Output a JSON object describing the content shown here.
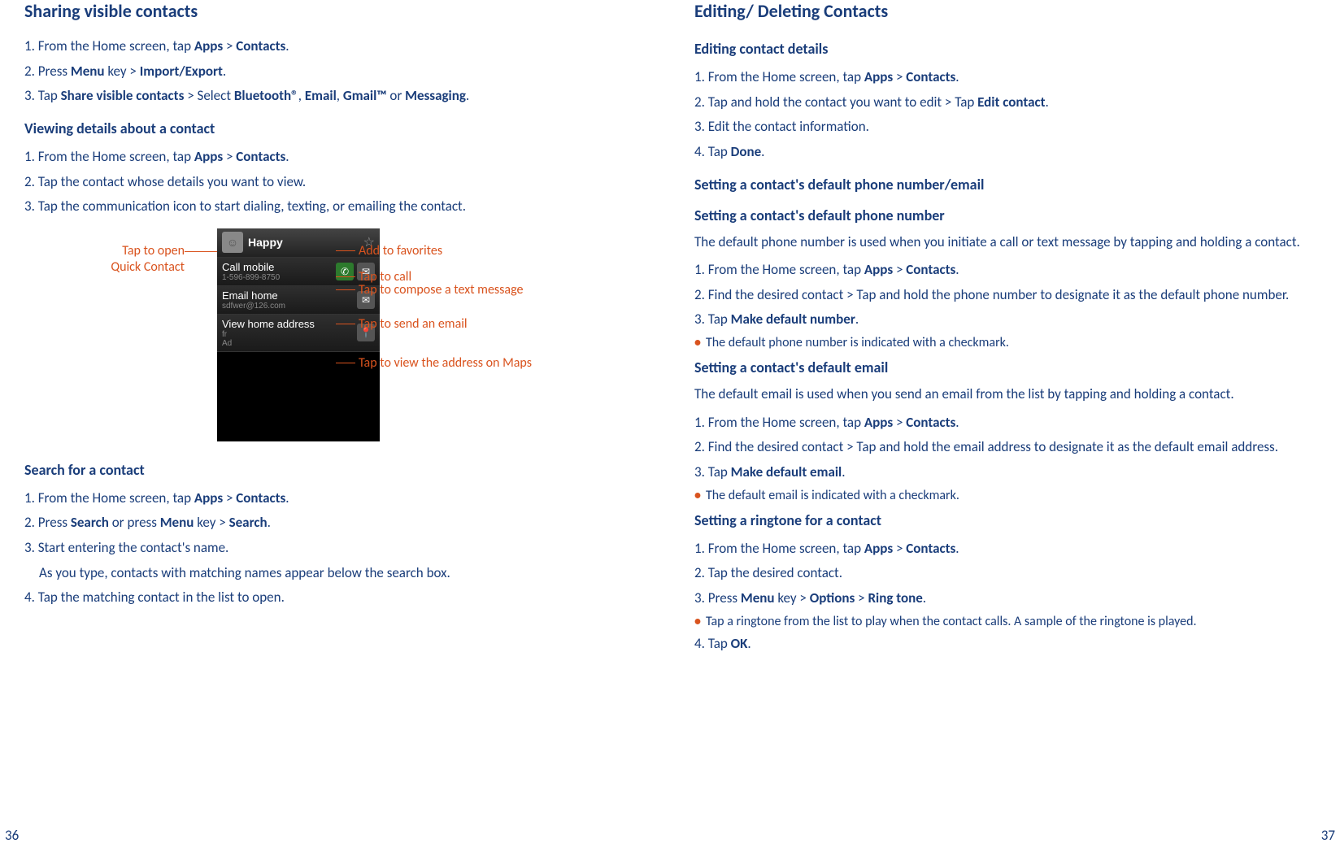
{
  "left": {
    "h_share": "Sharing visible contacts",
    "share_s1a": "1. From the Home screen, tap ",
    "share_s1b": "Apps",
    "share_s1c": " > ",
    "share_s1d": "Contacts",
    "share_s1e": ".",
    "share_s2a": "2. Press ",
    "share_s2b": "Menu",
    "share_s2c": " key > ",
    "share_s2d": "Import/Export",
    "share_s2e": ".",
    "share_s3a": "3. Tap ",
    "share_s3b": "Share visible contacts",
    "share_s3c": " > Select ",
    "share_s3d": "Bluetooth®",
    "share_s3e": ", ",
    "share_s3f": "Email",
    "share_s3g": ", ",
    "share_s3h": "Gmail™",
    "share_s3i": " or ",
    "share_s3j": "Messaging",
    "share_s3k": ".",
    "h_view": "Viewing details about a contact",
    "view_s1a": "1. From the Home screen, tap ",
    "view_s1b": "Apps",
    "view_s1c": " > ",
    "view_s1d": "Contacts",
    "view_s1e": ".",
    "view_s2": "2. Tap the contact whose details you want to view.",
    "view_s3": "3. Tap the communication icon to start dialing, texting, or emailing the contact.",
    "callout_left1": "Tap to open",
    "callout_left2": "Quick Contact",
    "co_fav": "Add to favorites",
    "co_call": "Tap to call",
    "co_sms": "Tap to compose a text message",
    "co_mail": "Tap to send an email",
    "co_map": "Tap to view the address on Maps",
    "phone": {
      "name": "Happy",
      "call_title": "Call mobile",
      "call_sub": "1-596-899-8750",
      "email_title": "Email home",
      "email_sub": "sdfwer@126.com",
      "addr_title": "View home address",
      "addr_sub1": "fr",
      "addr_sub2": "Ad"
    },
    "h_search": "Search for a contact",
    "search_s1a": "1. From the Home screen, tap ",
    "search_s1b": "Apps",
    "search_s1c": " > ",
    "search_s1d": "Contacts",
    "search_s1e": ".",
    "search_s2a": "2. Press ",
    "search_s2b": "Search",
    "search_s2c": " or press ",
    "search_s2d": "Menu",
    "search_s2e": " key > ",
    "search_s2f": "Search",
    "search_s2g": ".",
    "search_s3a": "3. Start entering the contact's name.",
    "search_s3b": "As you type, contacts with matching names appear below the search box.",
    "search_s4": "4. Tap the matching contact in the list to open.",
    "page_num": "36"
  },
  "right": {
    "h_main": "Editing/ Deleting Contacts",
    "h_edit": "Editing contact details",
    "edit_s1a": "1. From the Home screen, tap ",
    "edit_s1b": "Apps",
    "edit_s1c": " > ",
    "edit_s1d": "Contacts",
    "edit_s1e": ".",
    "edit_s2a": "2. Tap and hold the contact you want to edit > Tap ",
    "edit_s2b": "Edit contact",
    "edit_s2c": ".",
    "edit_s3": "3. Edit the contact information.",
    "edit_s4a": "4. Tap ",
    "edit_s4b": "Done",
    "edit_s4c": ".",
    "h_defpe": "Setting a contact's default phone number/email",
    "h_defp": "Setting a contact's default phone number",
    "defp_intro": "The default phone number is used when you initiate a call or text message by tapping and holding a contact.",
    "defp_s1a": "1. From the Home screen, tap ",
    "defp_s1b": "Apps",
    "defp_s1c": " > ",
    "defp_s1d": "Contacts",
    "defp_s1e": ".",
    "defp_s2": "2. Find the desired contact > Tap and hold the phone number to designate it as the default phone number.",
    "defp_s3a": "3. Tap ",
    "defp_s3b": "Make default number",
    "defp_s3c": ".",
    "defp_bullet": "The default phone number is indicated with a checkmark.",
    "h_defe": "Setting a contact's default email",
    "defe_intro": "The default email is used when you send an email from the list by tapping and holding a contact.",
    "defe_s1a": "1. From the Home screen, tap ",
    "defe_s1b": "Apps",
    "defe_s1c": " > ",
    "defe_s1d": "Contacts",
    "defe_s1e": ".",
    "defe_s2": "2. Find the desired contact > Tap and hold the email address to designate it as the default email address.",
    "defe_s3a": "3. Tap ",
    "defe_s3b": "Make default email",
    "defe_s3c": ".",
    "defe_bullet": "The default email is indicated with a checkmark.",
    "h_ring": "Setting a ringtone for a contact",
    "ring_s1a": "1. From the Home screen, tap ",
    "ring_s1b": "Apps",
    "ring_s1c": " > ",
    "ring_s1d": "Contacts",
    "ring_s1e": ".",
    "ring_s2": "2. Tap the desired contact.",
    "ring_s3a": "3. Press ",
    "ring_s3b": "Menu",
    "ring_s3c": " key > ",
    "ring_s3d": "Options",
    "ring_s3e": " > ",
    "ring_s3f": "Ring tone",
    "ring_s3g": ".",
    "ring_bullet": "Tap a ringtone from the list to play when the contact calls. A sample of the ringtone is played.",
    "ring_s4a": "4. Tap ",
    "ring_s4b": "OK",
    "ring_s4c": ".",
    "page_num": "37"
  }
}
